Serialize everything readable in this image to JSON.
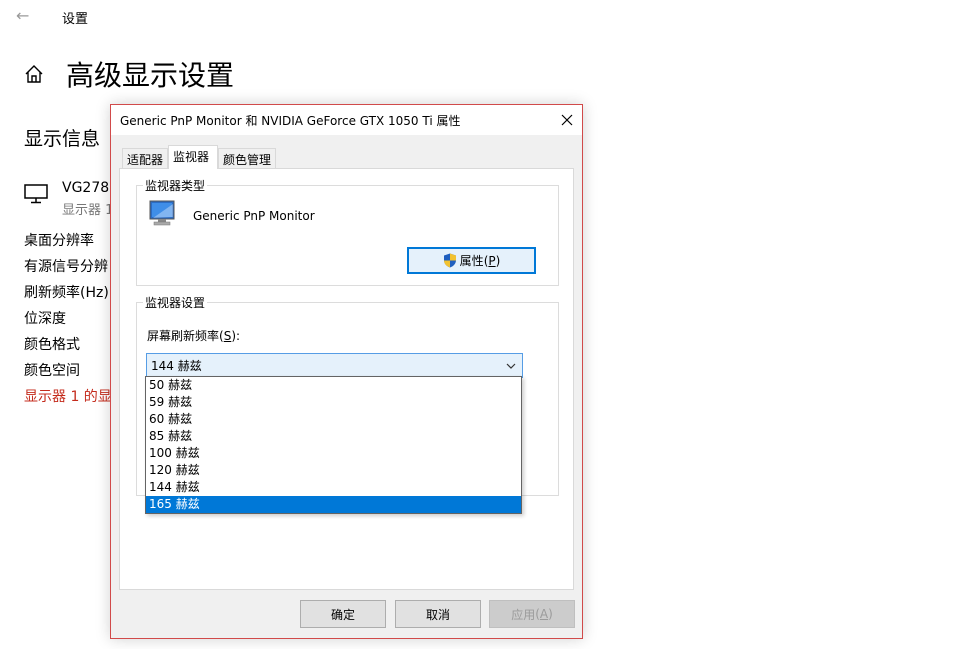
{
  "settings": {
    "nav_title": "设置",
    "page_title": "高级显示设置",
    "section_title": "显示信息",
    "monitor": {
      "name": "VG278",
      "subtitle": "显示器 1"
    },
    "info_items": [
      "桌面分辨率",
      "有源信号分辨",
      "刷新频率(Hz)",
      "位深度",
      "颜色格式",
      "颜色空间"
    ],
    "info_link": "显示器 1 的显"
  },
  "dialog": {
    "title": "Generic PnP Monitor 和 NVIDIA GeForce GTX 1050 Ti 属性",
    "tabs": [
      "适配器",
      "监视器",
      "颜色管理"
    ],
    "active_tab": "监视器",
    "monitor_type": {
      "group_label": "监视器类型",
      "name": "Generic PnP Monitor",
      "properties_label": "属性",
      "properties_key": "P"
    },
    "monitor_settings": {
      "group_label": "监视器设置",
      "refresh_label": "屏幕刷新频率",
      "refresh_key": "S",
      "selected_value": "144 赫兹",
      "options": [
        "50 赫兹",
        "59 赫兹",
        "60 赫兹",
        "85 赫兹",
        "100 赫兹",
        "120 赫兹",
        "144 赫兹",
        "165 赫兹"
      ],
      "highlighted_option": "165 赫兹"
    },
    "buttons": {
      "ok": "确定",
      "cancel": "取消",
      "apply": "应用",
      "apply_key": "A"
    }
  },
  "colors": {
    "accent": "#0078d7",
    "link_red": "#c42b1c",
    "dialog_border": "#d14a4a"
  }
}
